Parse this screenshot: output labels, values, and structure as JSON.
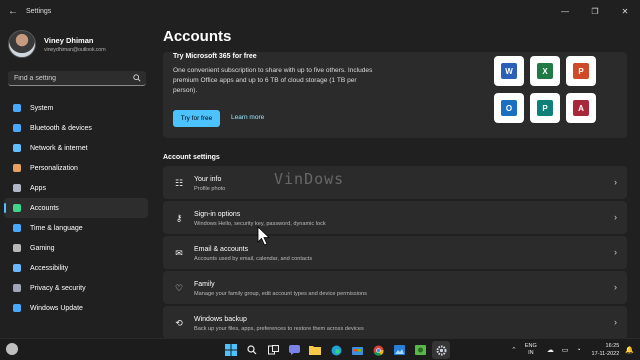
{
  "titlebar": {
    "title": "Settings",
    "back": "←",
    "minimize": "—",
    "maximize": "❐",
    "close": "✕"
  },
  "profile": {
    "name": "Viney Dhiman",
    "email": "vineydhiman@outlook.com"
  },
  "search": {
    "placeholder": "Find a setting"
  },
  "nav": [
    {
      "label": "System",
      "icon": "monitor-icon",
      "color": "#4aa8ff"
    },
    {
      "label": "Bluetooth & devices",
      "icon": "bluetooth-icon",
      "color": "#4aa8ff"
    },
    {
      "label": "Network & internet",
      "icon": "wifi-icon",
      "color": "#60c0ff"
    },
    {
      "label": "Personalization",
      "icon": "brush-icon",
      "color": "#e8a060"
    },
    {
      "label": "Apps",
      "icon": "apps-icon",
      "color": "#b0b8c8"
    },
    {
      "label": "Accounts",
      "icon": "person-icon",
      "color": "#3dd68c",
      "active": true
    },
    {
      "label": "Time & language",
      "icon": "globe-clock-icon",
      "color": "#4aa8ff"
    },
    {
      "label": "Gaming",
      "icon": "gamepad-icon",
      "color": "#b8b8b8"
    },
    {
      "label": "Accessibility",
      "icon": "accessibility-icon",
      "color": "#6ab8ff"
    },
    {
      "label": "Privacy & security",
      "icon": "shield-icon",
      "color": "#a0a8b8"
    },
    {
      "label": "Windows Update",
      "icon": "update-icon",
      "color": "#4aa8ff"
    }
  ],
  "page": {
    "title": "Accounts"
  },
  "promo": {
    "title": "Try Microsoft 365 for free",
    "desc": "One convenient subscription to share with up to five others. Includes premium Office apps and up to 6 TB of cloud storage (1 TB per person).",
    "try_label": "Try for free",
    "learn_label": "Learn more",
    "apps": [
      {
        "letter": "W",
        "icon": "word-icon",
        "color": "#2b5fb8"
      },
      {
        "letter": "X",
        "icon": "excel-icon",
        "color": "#1f7a45"
      },
      {
        "letter": "P",
        "icon": "powerpoint-icon",
        "color": "#d04a2a"
      },
      {
        "letter": "O",
        "icon": "outlook-icon",
        "color": "#1a6fc0"
      },
      {
        "letter": "P",
        "icon": "publisher-icon",
        "color": "#0f7f7a"
      },
      {
        "letter": "A",
        "icon": "access-icon",
        "color": "#a8283a"
      }
    ]
  },
  "section": {
    "title": "Account settings"
  },
  "rows": [
    {
      "title": "Your info",
      "desc": "Profile photo",
      "icon": "person-card-icon",
      "glyph": "☷"
    },
    {
      "title": "Sign-in options",
      "desc": "Windows Hello, security key, password, dynamic lock",
      "icon": "key-icon",
      "glyph": "⚷"
    },
    {
      "title": "Email & accounts",
      "desc": "Accounts used by email, calendar, and contacts",
      "icon": "mail-icon",
      "glyph": "✉"
    },
    {
      "title": "Family",
      "desc": "Manage your family group, edit account types and device permissions",
      "icon": "heart-icon",
      "glyph": "♡"
    },
    {
      "title": "Windows backup",
      "desc": "Back up your files, apps, preferences to restore them across devices",
      "icon": "backup-icon",
      "glyph": "⟲"
    }
  ],
  "watermark": "VinDows",
  "taskbar": {
    "lang_line1": "ENG",
    "lang_line2": "IN",
    "time": "16:25",
    "date": "17-11-2022",
    "chevron": "⌃",
    "tray_icons": "☁ ▭ ◔",
    "bell": "🔔"
  }
}
